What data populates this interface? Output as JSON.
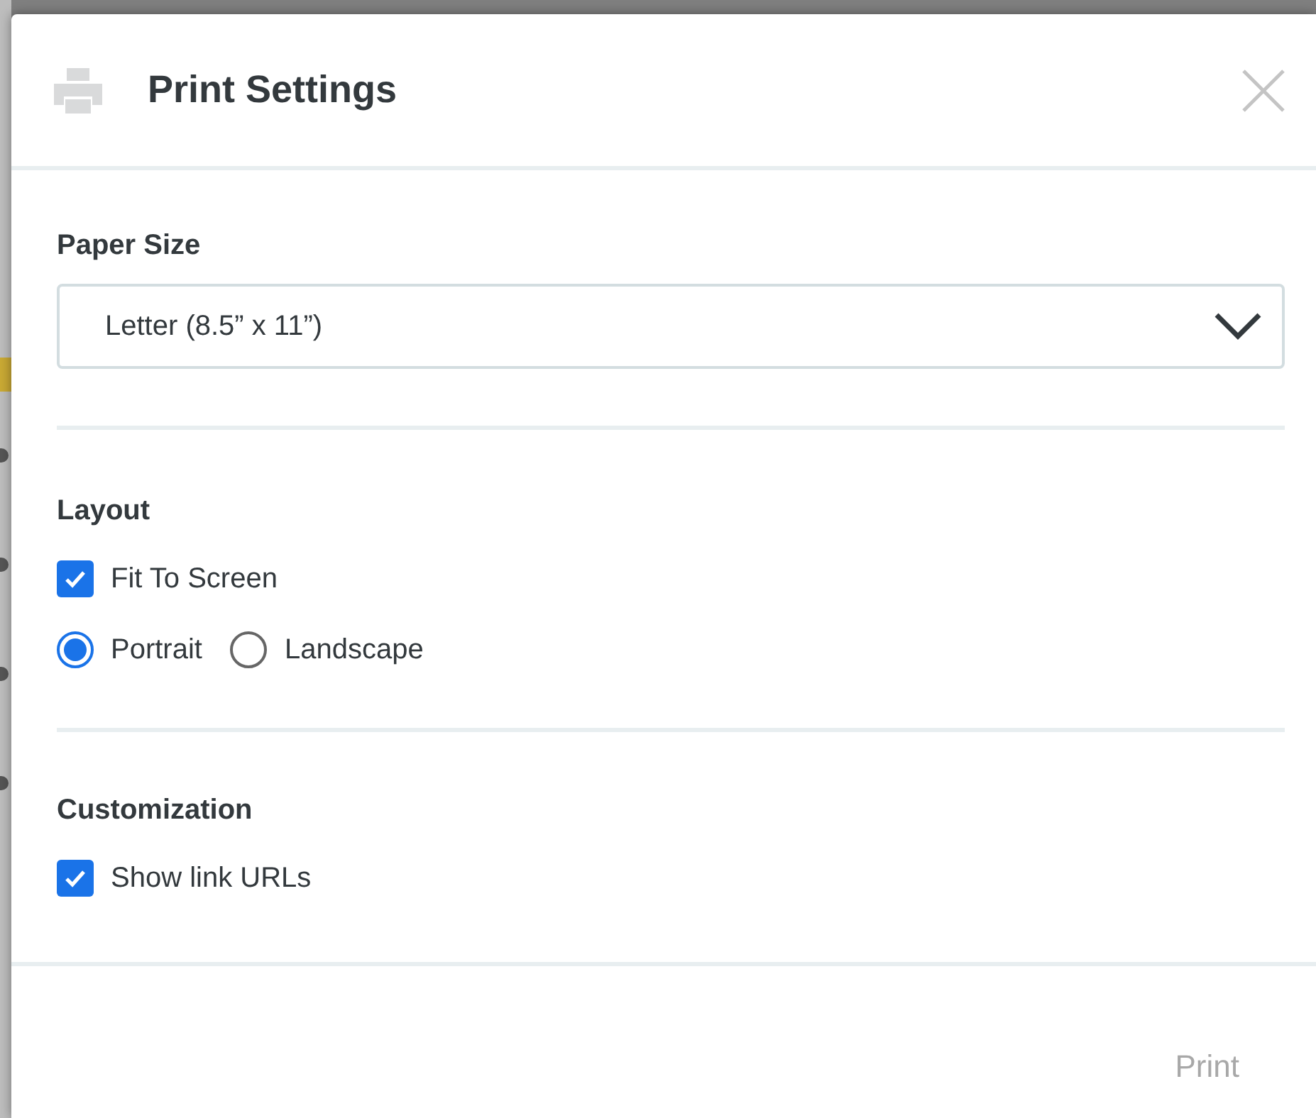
{
  "dialog": {
    "title": "Print Settings"
  },
  "paper_size": {
    "label": "Paper Size",
    "value": "Letter (8.5” x 11”)"
  },
  "layout": {
    "label": "Layout",
    "fit_to_screen": {
      "label": "Fit To Screen",
      "checked": true
    },
    "orientation": [
      {
        "label": "Portrait",
        "selected": true
      },
      {
        "label": "Landscape",
        "selected": false
      }
    ]
  },
  "customization": {
    "label": "Customization",
    "show_link_urls": {
      "label": "Show link URLs",
      "checked": true
    }
  },
  "footer": {
    "print_button": {
      "label": "Print",
      "disabled": true
    }
  }
}
